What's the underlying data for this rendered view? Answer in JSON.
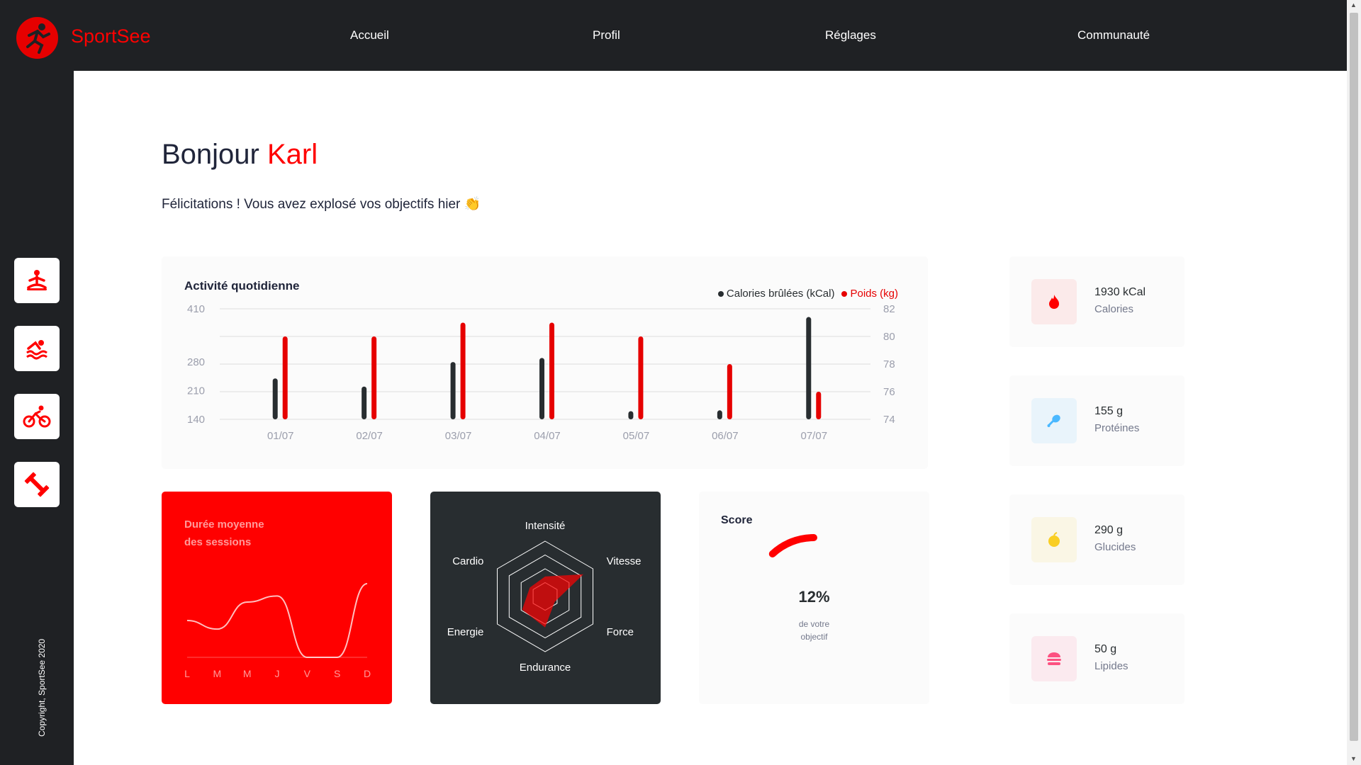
{
  "app": {
    "name": "SportSee",
    "copyright": "Copyright, SportSee 2020"
  },
  "nav": [
    "Accueil",
    "Profil",
    "Réglages",
    "Communauté"
  ],
  "sidebar_icons": [
    "yoga-icon",
    "swimming-icon",
    "cycling-icon",
    "dumbbell-icon"
  ],
  "greeting": {
    "prefix": "Bonjour ",
    "name": "Karl"
  },
  "subtitle": "Félicitations ! Vous avez explosé vos objectifs hier 👏",
  "colors": {
    "accent": "#ff0101",
    "dark": "#1f2124"
  },
  "chart_data": [
    {
      "type": "bar",
      "title": "Activité quotidienne",
      "categories": [
        "01/07",
        "02/07",
        "03/07",
        "04/07",
        "05/07",
        "06/07",
        "07/07"
      ],
      "series": [
        {
          "name": "Calories brûlées (kCal)",
          "color": "#282d30",
          "axis": "left",
          "values": [
            240,
            220,
            280,
            290,
            160,
            162,
            390
          ]
        },
        {
          "name": "Poids (kg)",
          "color": "#e60000",
          "axis": "right",
          "values": [
            80,
            80,
            81,
            81,
            80,
            78,
            76
          ]
        }
      ],
      "left_axis_ticks": [
        140,
        210,
        280,
        410
      ],
      "right_axis_ticks": [
        74,
        76,
        78,
        80,
        82
      ],
      "grid": true,
      "legend": "top-right"
    },
    {
      "type": "line",
      "title": "Durée moyenne des sessions",
      "categories": [
        "L",
        "M",
        "M",
        "J",
        "V",
        "S",
        "D"
      ],
      "values": [
        30,
        23,
        45,
        50,
        0,
        0,
        60
      ]
    },
    {
      "type": "radar",
      "categories": [
        "Intensité",
        "Vitesse",
        "Force",
        "Endurance",
        "Energie",
        "Cardio"
      ],
      "values": [
        90,
        200,
        50,
        140,
        120,
        80
      ],
      "max": 250
    },
    {
      "type": "radial",
      "title": "Score",
      "value": 0.12,
      "label_value": "12%",
      "label_text_1": "de votre",
      "label_text_2": "objectif"
    }
  ],
  "nutrition": [
    {
      "value": "1930 kCal",
      "label": "Calories",
      "icon": "flame-icon",
      "color": "#ff0000",
      "bg": "#fbeaea"
    },
    {
      "value": "155 g",
      "label": "Protéines",
      "icon": "chicken-icon",
      "color": "#4ab8ff",
      "bg": "#e9f4fb"
    },
    {
      "value": "290 g",
      "label": "Glucides",
      "icon": "apple-icon",
      "color": "#f9ce23",
      "bg": "#faf6e5"
    },
    {
      "value": "50 g",
      "label": "Lipides",
      "icon": "burger-icon",
      "color": "#fd5181",
      "bg": "#fbeaef"
    }
  ]
}
